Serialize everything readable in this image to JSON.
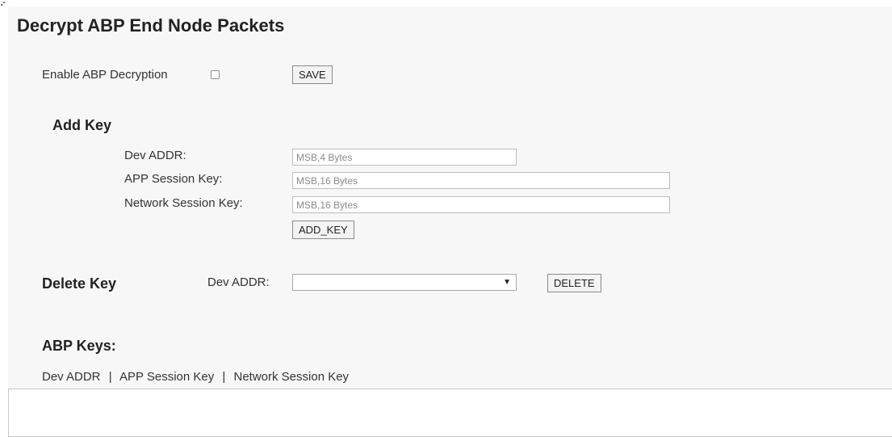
{
  "page": {
    "title": "Decrypt ABP End Node Packets"
  },
  "enable": {
    "label": "Enable ABP Decryption",
    "checked": false,
    "save_label": "SAVE"
  },
  "add_key": {
    "heading": "Add Key",
    "dev_addr_label": "Dev ADDR:",
    "dev_addr_placeholder": "MSB,4 Bytes",
    "app_key_label": "APP Session Key:",
    "app_key_placeholder": "MSB,16 Bytes",
    "nwk_key_label": "Network Session Key:",
    "nwk_key_placeholder": "MSB,16 Bytes",
    "add_label": "ADD_KEY"
  },
  "delete_key": {
    "heading": "Delete Key",
    "dev_addr_label": "Dev ADDR:",
    "selected_value": "",
    "delete_label": "DELETE"
  },
  "abp_keys": {
    "heading": "ABP Keys:",
    "columns": [
      "Dev ADDR",
      "APP Session Key",
      "Network Session Key"
    ],
    "separator": "|",
    "rows": []
  },
  "icons": {
    "dropdown": "chevron-down-icon"
  }
}
